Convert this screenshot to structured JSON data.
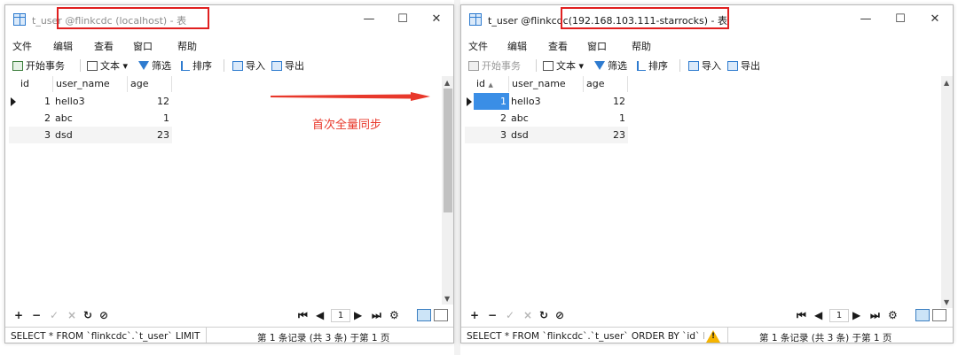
{
  "left_window": {
    "title_prefix": "t_user ",
    "title_highlight": "@flinkcdc (localhost) - 表",
    "window_buttons": [
      "—",
      "☐",
      "✕"
    ],
    "menu": [
      "文件",
      "编辑",
      "查看",
      "窗口",
      "帮助"
    ],
    "toolbar": {
      "begin_tx": "开始事务",
      "text": "文本 ▾",
      "filter": "筛选",
      "sort": "排序",
      "import": "导入",
      "export": "导出"
    },
    "columns": [
      "id",
      "user_name",
      "age"
    ],
    "rows": [
      {
        "id": "1",
        "user_name": "hello3",
        "age": "12"
      },
      {
        "id": "2",
        "user_name": "abc",
        "age": "1"
      },
      {
        "id": "3",
        "user_name": "dsd",
        "age": "23"
      }
    ],
    "page_number": "1",
    "sql": "SELECT * FROM `flinkcdc`.`t_user` LIMIT",
    "record_info": "第 1 条记录 (共 3 条) 于第 1 页"
  },
  "right_window": {
    "title_prefix": "t_user @flinkcdc",
    "title_highlight": "(192.168.103.111-starrocks) - 表",
    "window_buttons": [
      "—",
      "☐",
      "✕"
    ],
    "menu": [
      "文件",
      "编辑",
      "查看",
      "窗口",
      "帮助"
    ],
    "toolbar": {
      "begin_tx": "开始事务",
      "text": "文本 ▾",
      "filter": "筛选",
      "sort": "排序",
      "import": "导入",
      "export": "导出"
    },
    "columns": [
      "id",
      "user_name",
      "age"
    ],
    "rows": [
      {
        "id": "1",
        "user_name": "hello3",
        "age": "12"
      },
      {
        "id": "2",
        "user_name": "abc",
        "age": "1"
      },
      {
        "id": "3",
        "user_name": "dsd",
        "age": "23"
      }
    ],
    "page_number": "1",
    "sql": "SELECT * FROM `flinkcdc`.`t_user` ORDER BY `id` LI",
    "record_info": "第 1 条记录 (共 3 条) 于第 1 页"
  },
  "annotation": {
    "label": "首次全量同步",
    "color": "#e8382b"
  },
  "colors": {
    "highlight_box": "#e02020",
    "selected_cell": "#3a8ee6",
    "warning": "#f5b400"
  }
}
